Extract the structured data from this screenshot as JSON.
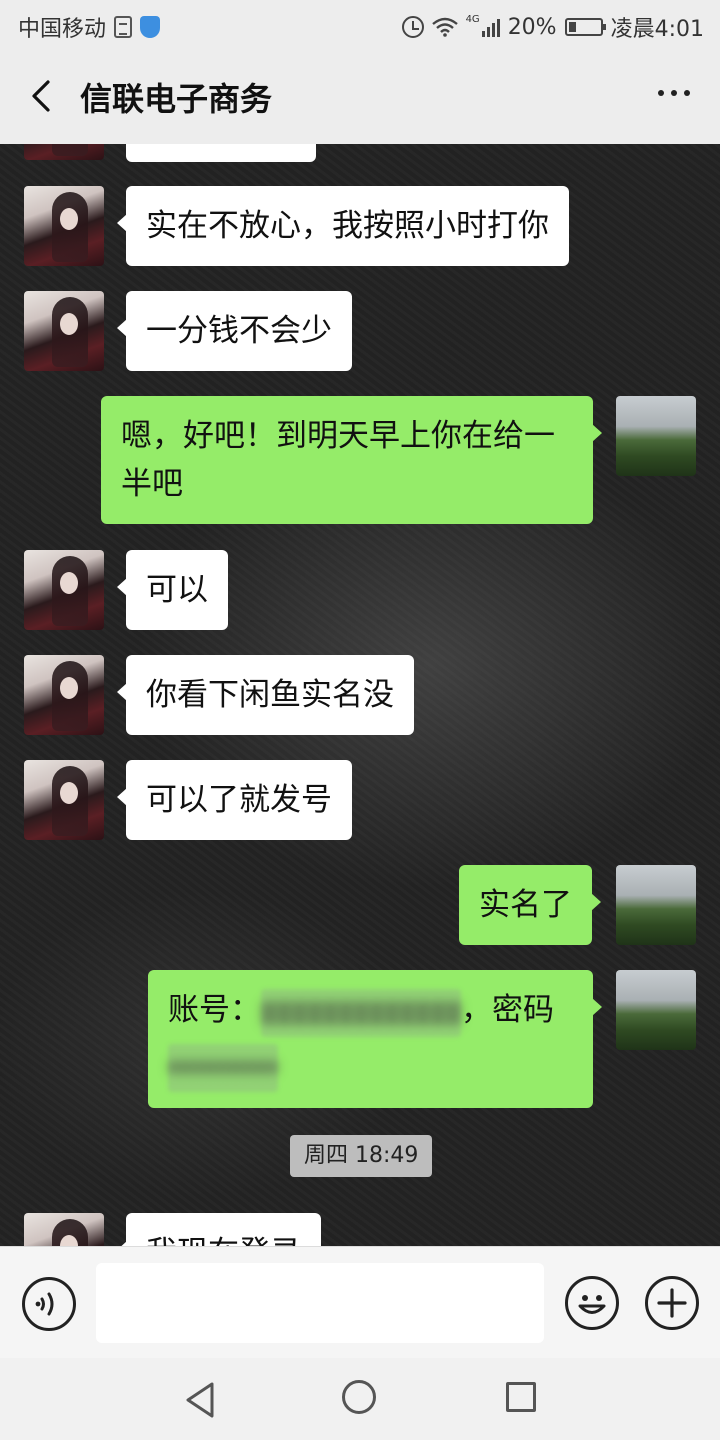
{
  "status_bar": {
    "carrier": "中国移动",
    "network": "4G",
    "battery": "20%",
    "time": "凌晨4:01",
    "icons": [
      "document-icon",
      "shield-icon",
      "alarm-icon",
      "wifi-icon",
      "signal-icon",
      "battery-icon"
    ]
  },
  "header": {
    "title": "信联电子商务",
    "back_icon": "chevron-left-icon",
    "more_icon": "more-dots-icon"
  },
  "messages": [
    {
      "side": "left",
      "text": "实在不放心，我按照小时打你"
    },
    {
      "side": "left",
      "text": "一分钱不会少"
    },
    {
      "side": "right",
      "line1": "嗯，好吧！到明天早上你在给一",
      "line2": "半吧"
    },
    {
      "side": "left",
      "text": "可以"
    },
    {
      "side": "left",
      "text": "你看下闲鱼实名没"
    },
    {
      "side": "left",
      "text": "可以了就发号"
    },
    {
      "side": "right",
      "text": "实名了"
    },
    {
      "side": "right",
      "account_label": "账号：",
      "account_value": "▓▓▓▓▓▓▓▓▓▓▓▓▓",
      "password_label": "，密码",
      "password_value": "▓▓▓▓▓▓▓▓▓▓▓▓▓"
    },
    {
      "side": "left",
      "text": "我现在登录"
    }
  ],
  "timestamp": "周四 18:49",
  "input_bar": {
    "placeholder": "",
    "icons": [
      "voice-icon",
      "emoji-icon",
      "plus-icon"
    ]
  },
  "nav_bar": {
    "icons": [
      "nav-back-icon",
      "nav-home-icon",
      "nav-recent-icon"
    ]
  },
  "colors": {
    "bubble_left": "#ffffff",
    "bubble_right": "#95ec69",
    "header_bg": "#ededed",
    "chat_bg": "#232323"
  }
}
